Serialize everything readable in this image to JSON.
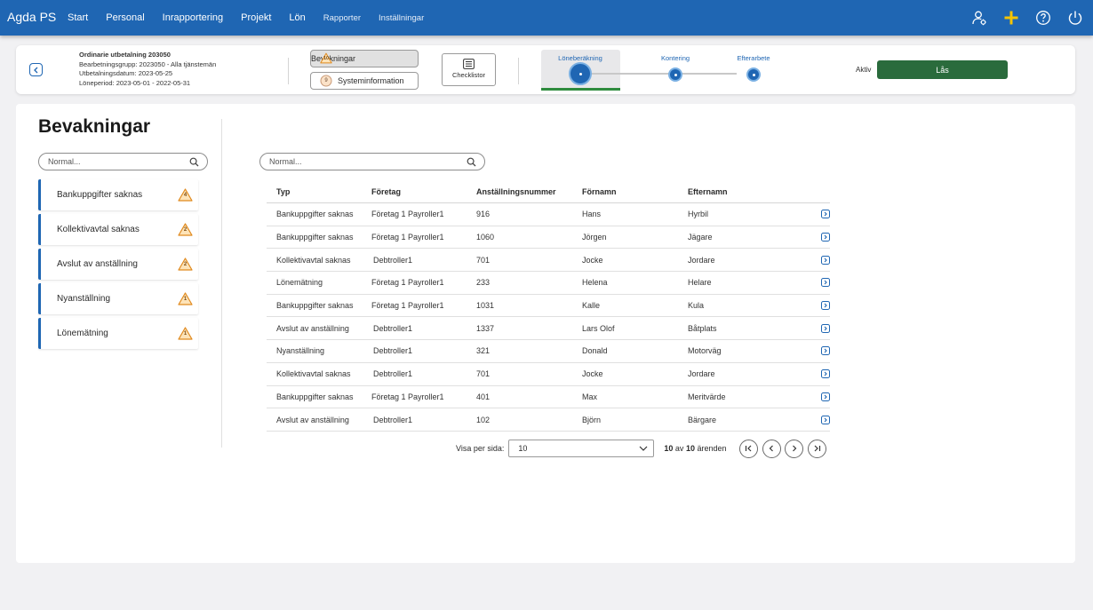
{
  "app": {
    "title": "Agda PS"
  },
  "nav": {
    "items": [
      {
        "label": "Start"
      },
      {
        "label": "Personal"
      },
      {
        "label": "Inrapportering"
      },
      {
        "label": "Projekt"
      },
      {
        "label": "Lön"
      },
      {
        "label": "Rapporter"
      },
      {
        "label": "Inställningar"
      }
    ],
    "icons": [
      "user-settings-icon",
      "plus-icon",
      "help-icon",
      "power-icon"
    ],
    "accent_color": "#1f66b3",
    "plus_color": "#f5c400"
  },
  "run": {
    "title": "Ordinarie utbetalning 203050",
    "group": "Bearbetningsgrupp: 2023050 - Alla tjänstemän",
    "payout_date": "Utbetalningsdatum: 2023-05-25",
    "period": "Löneperiod: 2023-05-01 - 2022-05-31"
  },
  "header_buttons": {
    "bevakningar": {
      "label": "Bevakningar",
      "count": "10"
    },
    "systeminformation": {
      "label": "Systeminformation",
      "count": "9"
    },
    "checklistor": {
      "label": "Checklistor"
    }
  },
  "stepper": {
    "steps": [
      {
        "label": "Löneberäkning",
        "active": true
      },
      {
        "label": "Kontering",
        "active": false
      },
      {
        "label": "Efterarbete",
        "active": false
      }
    ],
    "progress_color": "#2e8b3e"
  },
  "status": {
    "label": "Aktiv",
    "lock_button": "Lås",
    "lock_color": "#2a6b3c"
  },
  "page": {
    "title": "Bevakningar",
    "left_search_placeholder": "Normal...",
    "right_search_placeholder": "Normal..."
  },
  "categories": [
    {
      "label": "Bankuppgifter saknas",
      "count": "4"
    },
    {
      "label": "Kollektivavtal saknas",
      "count": "2"
    },
    {
      "label": "Avslut av anställning",
      "count": "2"
    },
    {
      "label": "Nyanställning",
      "count": "1"
    },
    {
      "label": "Lönemätning",
      "count": "1"
    }
  ],
  "table": {
    "columns": [
      "Typ",
      "Företag",
      "Anställningsnummer",
      "Förnamn",
      "Efternamn"
    ],
    "rows": [
      [
        "Bankuppgifter saknas",
        "Företag 1 Payroller1",
        "916",
        "Hans",
        "Hyrbil"
      ],
      [
        "Bankuppgifter saknas",
        "Företag 1 Payroller1",
        "1060",
        "Jörgen",
        "Jägare"
      ],
      [
        "Kollektivavtal saknas",
        "Debtroller1",
        "701",
        "Jocke",
        "Jordare"
      ],
      [
        "Lönemätning",
        "Företag 1 Payroller1",
        "233",
        "Helena",
        "Helare"
      ],
      [
        "Bankuppgifter saknas",
        "Företag 1 Payroller1",
        "1031",
        "Kalle",
        "Kula"
      ],
      [
        "Avslut av anställning",
        "Debtroller1",
        "1337",
        "Lars Olof",
        "Båtplats"
      ],
      [
        "Nyanställning",
        "Debtroller1",
        "321",
        "Donald",
        "Motorväg"
      ],
      [
        "Kollektivavtal saknas",
        "Debtroller1",
        "701",
        "Jocke",
        "Jordare"
      ],
      [
        "Bankuppgifter saknas",
        "Företag 1 Payroller1",
        "401",
        "Max",
        "Meritvärde"
      ],
      [
        "Avslut av anställning",
        "Debtroller1",
        "102",
        "Björn",
        "Bärgare"
      ]
    ]
  },
  "pagination": {
    "per_page_label": "Visa per sida:",
    "per_page_value": "10",
    "shown": "10",
    "of_word": "av",
    "total": "10",
    "unit": "ärenden"
  }
}
